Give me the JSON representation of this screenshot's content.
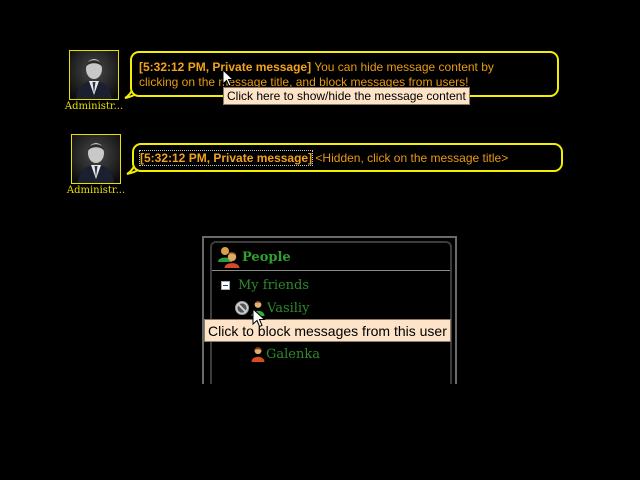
{
  "messages": [
    {
      "author": "Administr...",
      "title": "[5:32:12 PM, Private message]",
      "line1": " You can hide message content by",
      "line2": "clicking on the message title, and block messages from users!"
    },
    {
      "author": "Administr...",
      "title": "[5:32:12 PM, Private message]",
      "hidden_text": " <Hidden, click on the message title>"
    }
  ],
  "tooltips": {
    "message_toggle": "Click here to show/hide the message content",
    "block_user": "Click to block messages from this user"
  },
  "people_panel": {
    "title": "People",
    "group": "My friends",
    "contacts": [
      "Vasiliy",
      "Galenka"
    ]
  },
  "colors": {
    "bubble_border": "#f2f000",
    "title_text": "#f2a21a",
    "body_text": "#e79a12",
    "contact_text": "#2e8a2e",
    "tooltip_bg": "#fde4c8"
  },
  "icons": [
    "user-avatar-icon",
    "people-icon",
    "collapse-icon",
    "block-icon",
    "user-male-icon",
    "user-female-icon",
    "mouse-cursor-icon"
  ]
}
